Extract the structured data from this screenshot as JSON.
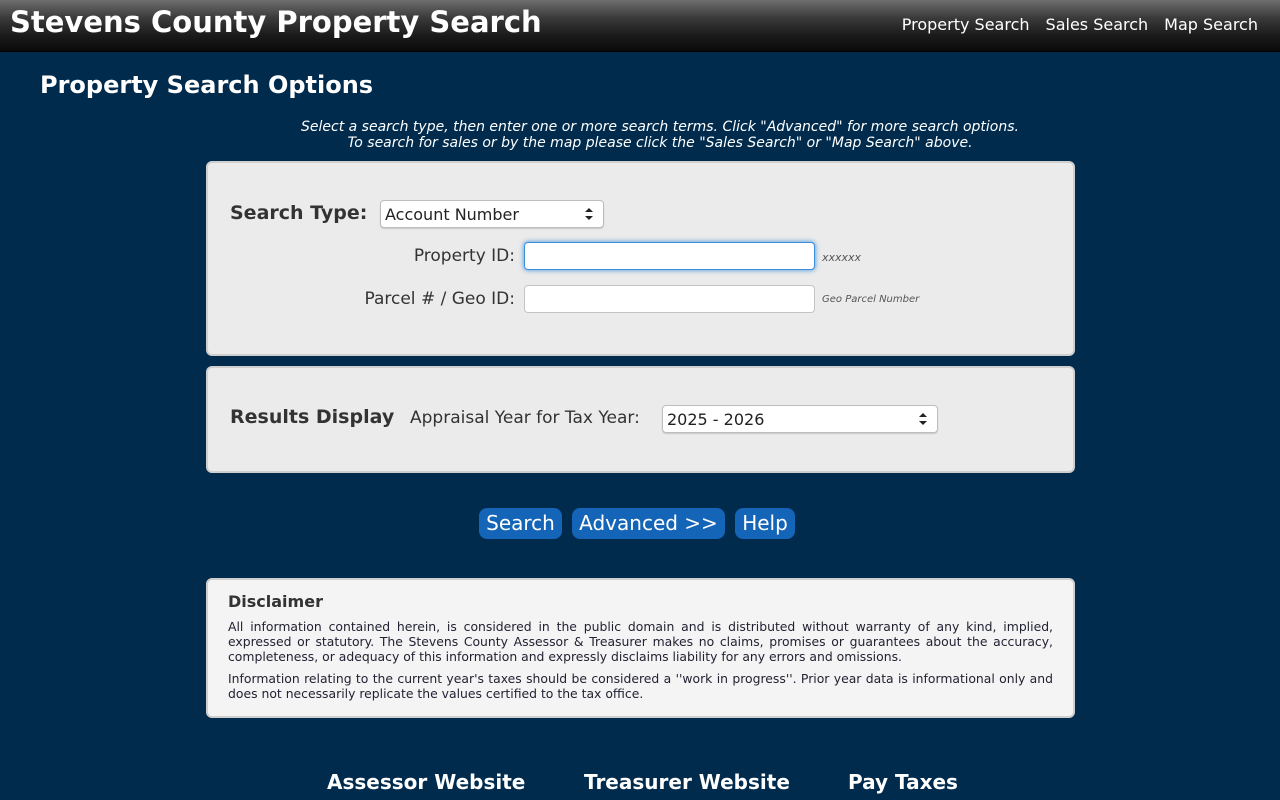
{
  "header": {
    "title": "Stevens County Property Search",
    "nav": [
      "Property Search",
      "Sales Search",
      "Map Search"
    ]
  },
  "page": {
    "heading": "Property Search Options",
    "instructions": [
      "Select a search type, then enter one or more search terms. Click \"Advanced\" for more search options.",
      "To search for sales or by the map please click the \"Sales Search\" or \"Map Search\" above."
    ]
  },
  "search_panel": {
    "search_type_label": "Search Type:",
    "search_type_value": "Account Number",
    "property_id_label": "Property ID:",
    "property_id_value": "",
    "property_id_hint": "xxxxxx",
    "parcel_label": "Parcel # / Geo ID:",
    "parcel_value": "",
    "parcel_hint": "Geo Parcel Number"
  },
  "results_panel": {
    "title": "Results Display",
    "year_label": "Appraisal Year for Tax Year:",
    "year_value": "2025 - 2026"
  },
  "buttons": {
    "search": "Search",
    "advanced": "Advanced >>",
    "help": "Help"
  },
  "disclaimer": {
    "title": "Disclaimer",
    "paragraphs": [
      "All information contained herein, is considered in the public domain and is distributed without warranty of any kind, implied, expressed or statutory. The Stevens County Assessor & Treasurer makes no claims, promises or guarantees about the accuracy, completeness, or adequacy of this information and expressly disclaims liability for any errors and omissions.",
      "Information relating to the current year's taxes should be considered a ''work in progress''. Prior year data is informational only and does not necessarily replicate the values certified to the tax office."
    ]
  },
  "footer": {
    "links": [
      "Assessor Website",
      "Treasurer Website",
      "Pay Taxes"
    ]
  },
  "colors": {
    "background": "#002b4d",
    "button": "#1465b8",
    "focus": "#3c8fdc"
  }
}
